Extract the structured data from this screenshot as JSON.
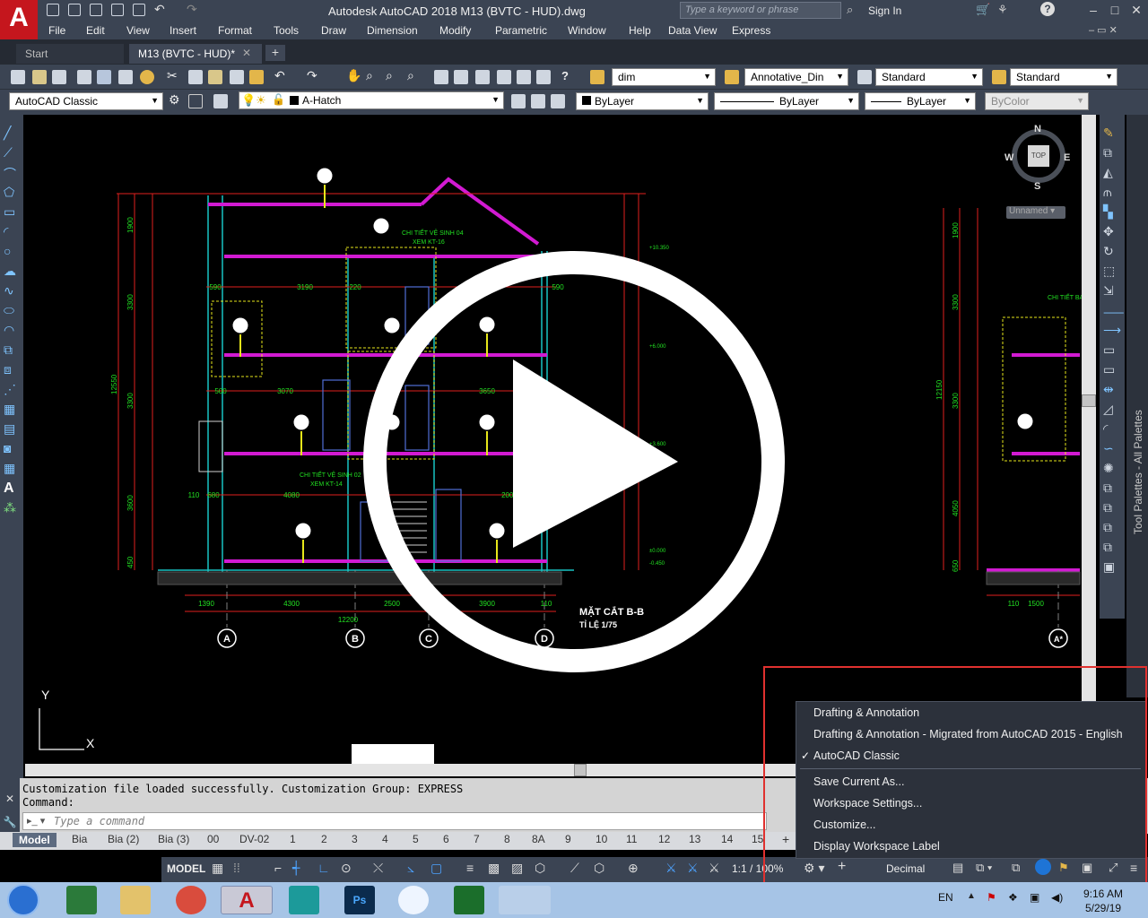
{
  "app": {
    "logo": "A",
    "title": "Autodesk AutoCAD 2018    M13 (BVTC - HUD).dwg",
    "search_placeholder": "Type a keyword or phrase",
    "sign_in": "Sign In"
  },
  "menu": [
    "File",
    "Edit",
    "View",
    "Insert",
    "Format",
    "Tools",
    "Draw",
    "Dimension",
    "Modify",
    "Parametric",
    "Window",
    "Help",
    "Data View",
    "Express"
  ],
  "tabs": {
    "start": "Start",
    "active": "M13 (BVTC - HUD)*",
    "new": "+"
  },
  "toolbar1": {
    "dim_style": "dim",
    "annotative": "Annotative_Din",
    "text_style": "Standard",
    "table_style": "Standard"
  },
  "toolbar2": {
    "workspace": "AutoCAD Classic",
    "layer": "A-Hatch",
    "color": "ByLayer",
    "linetype": "ByLayer",
    "lineweight": "ByLayer",
    "plotstyle": "ByColor"
  },
  "viewcube": {
    "north": "N",
    "south": "S",
    "east": "E",
    "west": "W",
    "top": "TOP",
    "ucs": "Unnamed"
  },
  "drawing": {
    "section_title": "MẶT CẮT B-B",
    "section_scale": "TỈ LỆ 1/75",
    "note_1": "CHI TIẾT VỆ SINH 04",
    "note_1_ref": "XEM KT-16",
    "note_2": "CHI TIẾT VỆ SINH 02",
    "note_2_ref": "XEM KT-14",
    "note_3": "CHI TIẾT BAN",
    "axes": [
      "A",
      "B",
      "C",
      "D"
    ],
    "dims_bottom": [
      "1390",
      "4300",
      "2500",
      "3900",
      "110"
    ],
    "dim_total": "12200",
    "dims_left": [
      "1900",
      "3300",
      "3300",
      "3600",
      "450"
    ],
    "dim_height": "12550",
    "dims_row1": [
      "590",
      "3190",
      "220",
      "590"
    ],
    "dims_row2": [
      "500",
      "3070",
      "3650"
    ],
    "dims_row3": [
      "110",
      "680",
      "4080",
      "2000"
    ],
    "levels": [
      "+10.350",
      "+6.000",
      "+3.600",
      "±0.000",
      "-0.450"
    ],
    "right_dims": [
      "1900",
      "3300",
      "12150",
      "3300",
      "4050",
      "650"
    ],
    "right_bottom": [
      "110",
      "1500"
    ],
    "right_axis": "A*",
    "ucs_x": "X",
    "ucs_y": "Y"
  },
  "command": {
    "line1": "Customization file loaded successfully. Customization Group: EXPRESS",
    "line2": "Command:",
    "placeholder": "Type a command"
  },
  "layout_tabs": [
    "Model",
    "Bia",
    "Bia (2)",
    "Bia (3)",
    "00",
    "DV-02",
    "1",
    "2",
    "3",
    "4",
    "5",
    "6",
    "7",
    "8",
    "8A",
    "9",
    "10",
    "11",
    "12",
    "13",
    "14",
    "15"
  ],
  "status": {
    "model": "MODEL",
    "scale": "1:1 / 100%",
    "units": "Decimal"
  },
  "workspace_menu": {
    "items": [
      "Drafting & Annotation",
      "Drafting & Annotation - Migrated from AutoCAD 2015 - English",
      "AutoCAD Classic"
    ],
    "checked": "✓",
    "actions": [
      "Save Current As...",
      "Workspace Settings...",
      "Customize...",
      "Display Workspace Label"
    ]
  },
  "palettes_label": "Tool Palettes - All Palettes",
  "taskbar": {
    "lang": "EN",
    "time": "9:16 AM",
    "date": "5/29/19"
  },
  "colors": {
    "chrome": "#3b4453",
    "highlight_border": "#e0312f",
    "magenta": "#d21ad2",
    "cyan": "#19c3c3",
    "red_dim": "#e0201e",
    "yellow": "#e6e61a",
    "green_text": "#22e022"
  }
}
